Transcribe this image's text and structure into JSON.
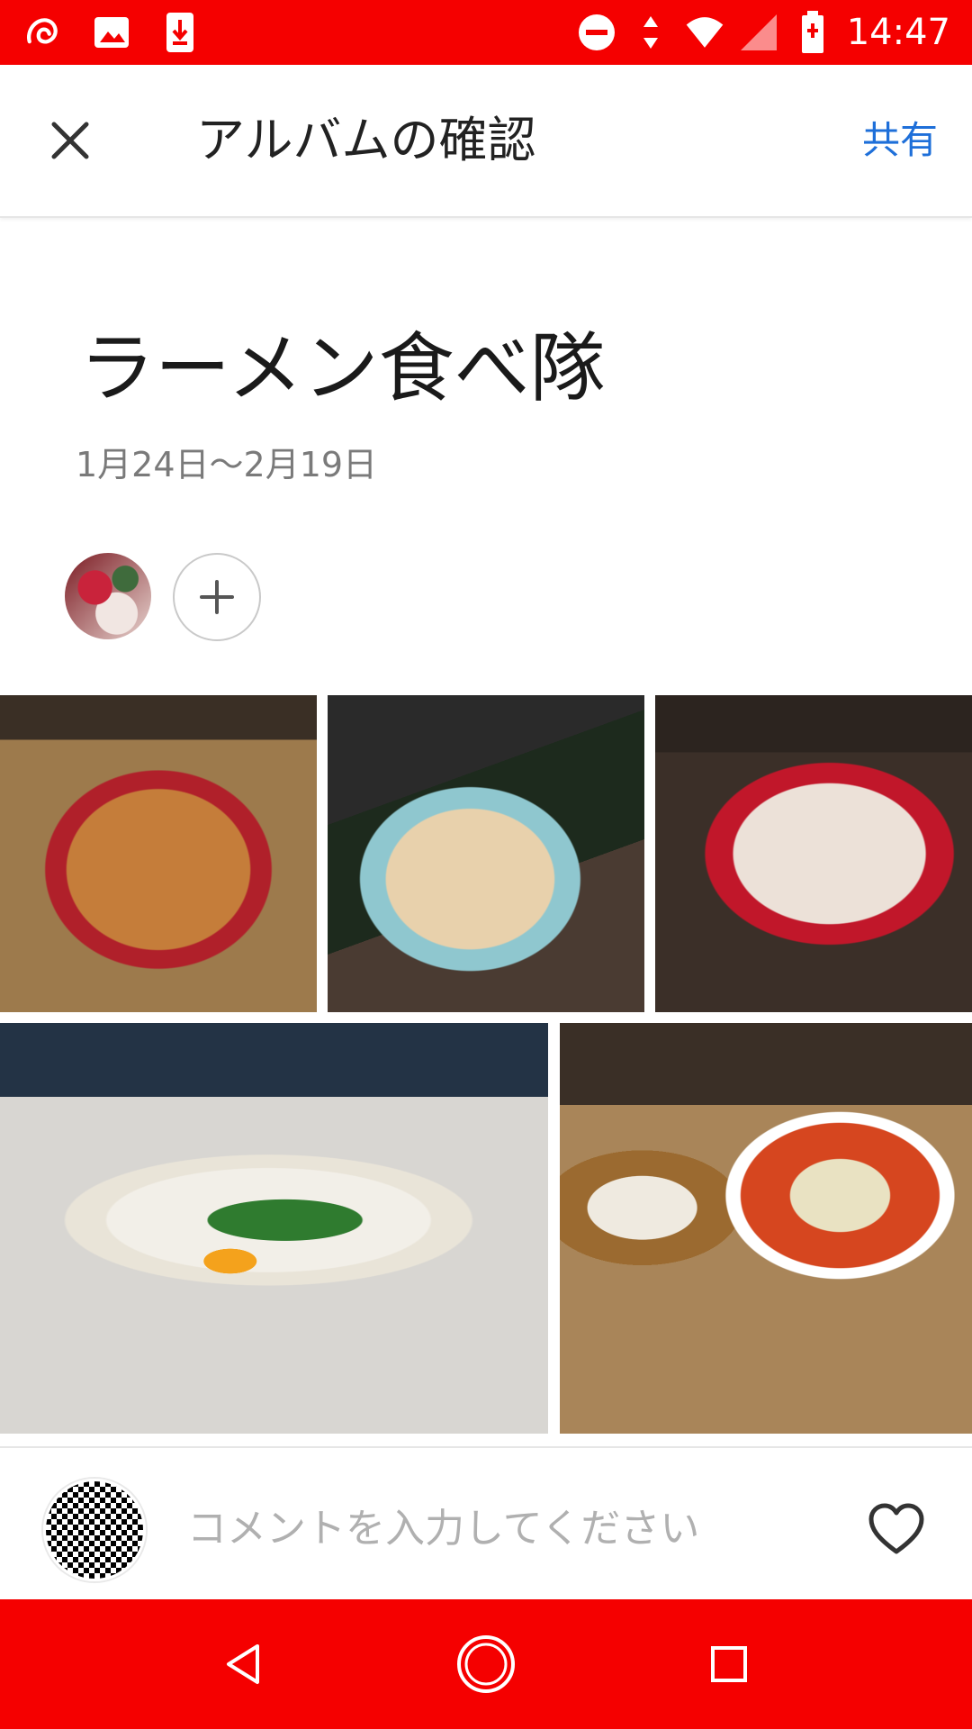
{
  "status_bar": {
    "time": "14:47",
    "icons": [
      "app-logo-icon",
      "image-icon",
      "download-icon",
      "do-not-disturb-icon",
      "data-arrows-icon",
      "wifi-icon",
      "signal-icon",
      "battery-icon"
    ]
  },
  "header": {
    "title": "アルバムの確認",
    "share_label": "共有",
    "close_icon": "close-icon"
  },
  "album": {
    "title": "ラーメン食べ隊",
    "date_range": "1月24日〜2月19日",
    "add_member_icon": "plus-icon"
  },
  "photos": [
    {
      "name": "photo-1"
    },
    {
      "name": "photo-2"
    },
    {
      "name": "photo-3"
    },
    {
      "name": "photo-4"
    },
    {
      "name": "photo-5"
    }
  ],
  "comment": {
    "placeholder": "コメントを入力してください",
    "like_icon": "heart-icon"
  },
  "colors": {
    "accent_red": "#f50000",
    "link_blue": "#1e6fd9"
  }
}
